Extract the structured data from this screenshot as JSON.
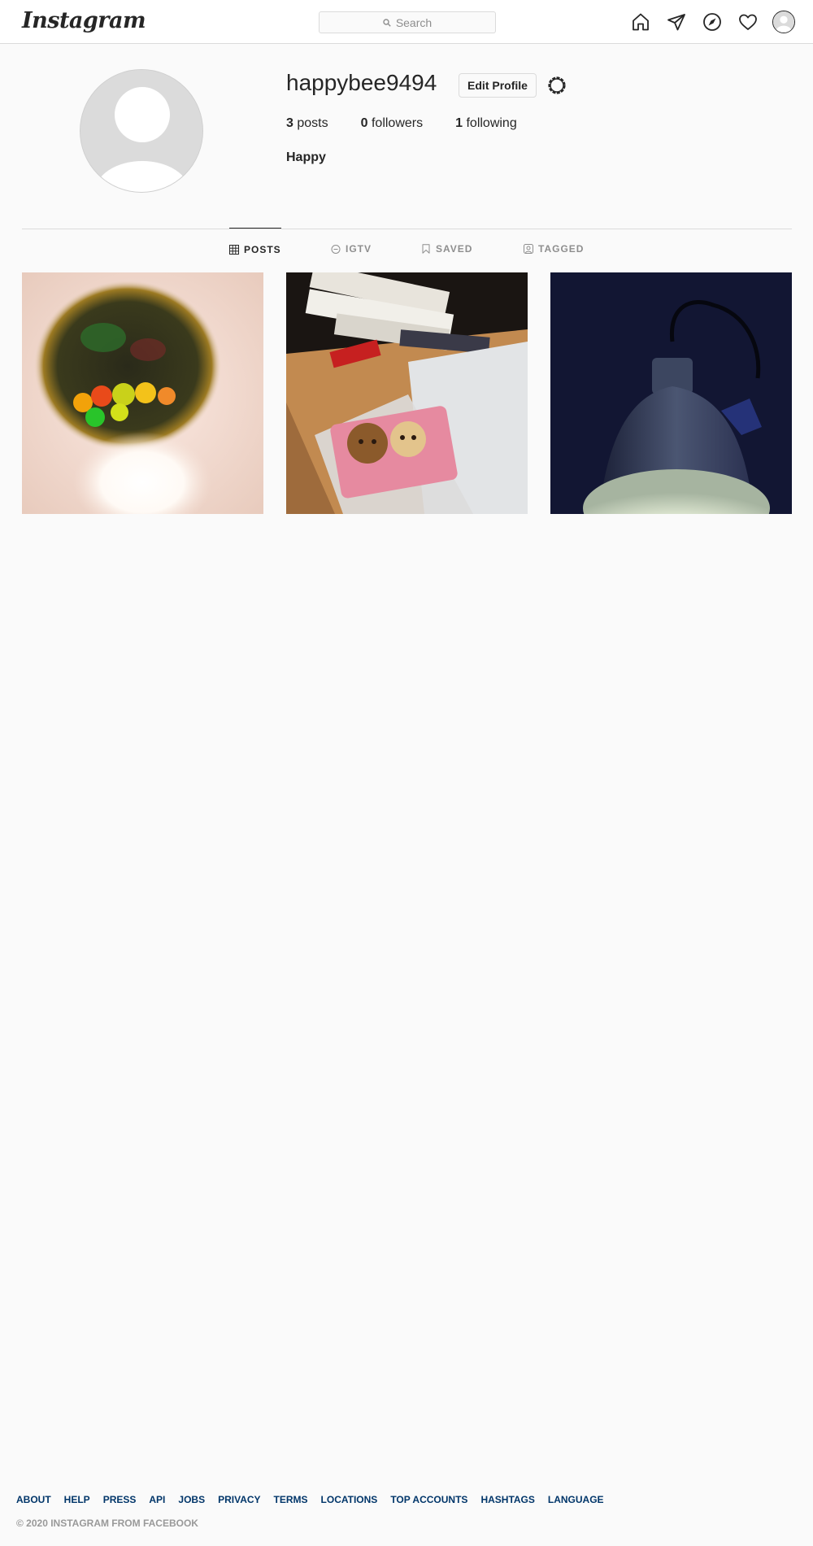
{
  "header": {
    "logo_text": "Instagram",
    "search_placeholder": "Search"
  },
  "nav": {
    "icons": [
      "home-icon",
      "direct-icon",
      "explore-icon",
      "activity-icon",
      "profile-avatar"
    ]
  },
  "profile": {
    "username": "happybee9494",
    "edit_label": "Edit Profile",
    "stats": {
      "posts_count": "3",
      "posts_label": "posts",
      "followers_count": "0",
      "followers_label": "followers",
      "following_count": "1",
      "following_label": "following"
    },
    "bio": "Happy"
  },
  "tabs": {
    "posts": "POSTS",
    "igtv": "IGTV",
    "saved": "SAVED",
    "tagged": "TAGGED"
  },
  "footer": {
    "links": {
      "about": "ABOUT",
      "help": "HELP",
      "press": "PRESS",
      "api": "API",
      "jobs": "JOBS",
      "privacy": "PRIVACY",
      "terms": "TERMS",
      "locations": "LOCATIONS",
      "top_accounts": "TOP ACCOUNTS",
      "hashtags": "HASHTAGS",
      "language": "LANGUAGE"
    },
    "copyright": "© 2020 INSTAGRAM FROM FACEBOOK"
  },
  "colors": {
    "background": "#fafafa",
    "border": "#dbdbdb",
    "text": "#262626",
    "muted": "#8e8e8e",
    "link": "#003569"
  }
}
